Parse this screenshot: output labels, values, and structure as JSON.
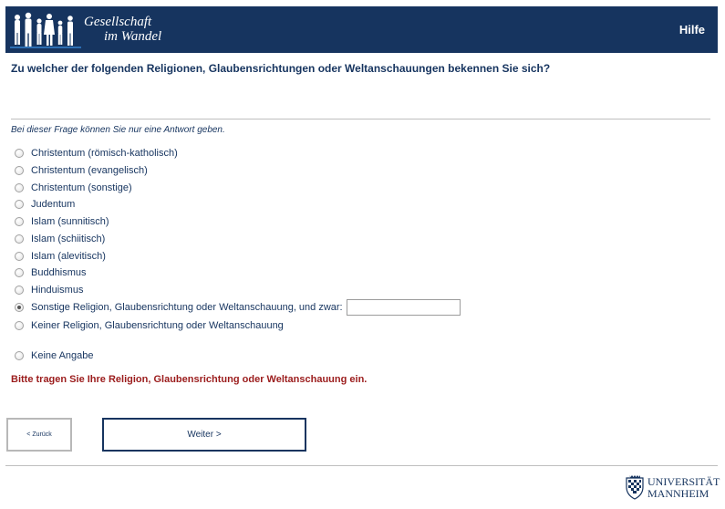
{
  "header": {
    "logo_line1": "Gesellschaft",
    "logo_line2": "im Wandel",
    "help_label": "Hilfe",
    "background_color": "#16345f"
  },
  "question": "Zu welcher der folgenden Religionen, Glaubensrichtungen oder Weltanschauungen bekennen Sie sich?",
  "instruction": "Bei dieser Frage können Sie nur eine Antwort geben.",
  "options": [
    {
      "label": "Christentum (römisch-katholisch)",
      "selected": false
    },
    {
      "label": "Christentum (evangelisch)",
      "selected": false
    },
    {
      "label": "Christentum (sonstige)",
      "selected": false
    },
    {
      "label": "Judentum",
      "selected": false
    },
    {
      "label": "Islam (sunnitisch)",
      "selected": false
    },
    {
      "label": "Islam (schiitisch)",
      "selected": false
    },
    {
      "label": "Islam (alevitisch)",
      "selected": false
    },
    {
      "label": "Buddhismus",
      "selected": false
    },
    {
      "label": "Hinduismus",
      "selected": false
    },
    {
      "label": "Sonstige Religion, Glaubensrichtung oder Weltanschauung, und zwar:",
      "selected": true,
      "input_value": ""
    },
    {
      "label": "Keiner Religion, Glaubensrichtung oder Weltanschauung",
      "selected": false
    },
    {
      "label": "Keine Angabe",
      "selected": false
    }
  ],
  "error_message": "Bitte tragen Sie Ihre Religion, Glaubensrichtung oder Weltanschauung ein.",
  "error_color": "#9b1c1c",
  "buttons": {
    "back_label": "< Zurück",
    "next_label": "Weiter >"
  },
  "footer": {
    "university_line1": "UNIVERSITÄT",
    "university_line2": "MANNHEIM"
  }
}
